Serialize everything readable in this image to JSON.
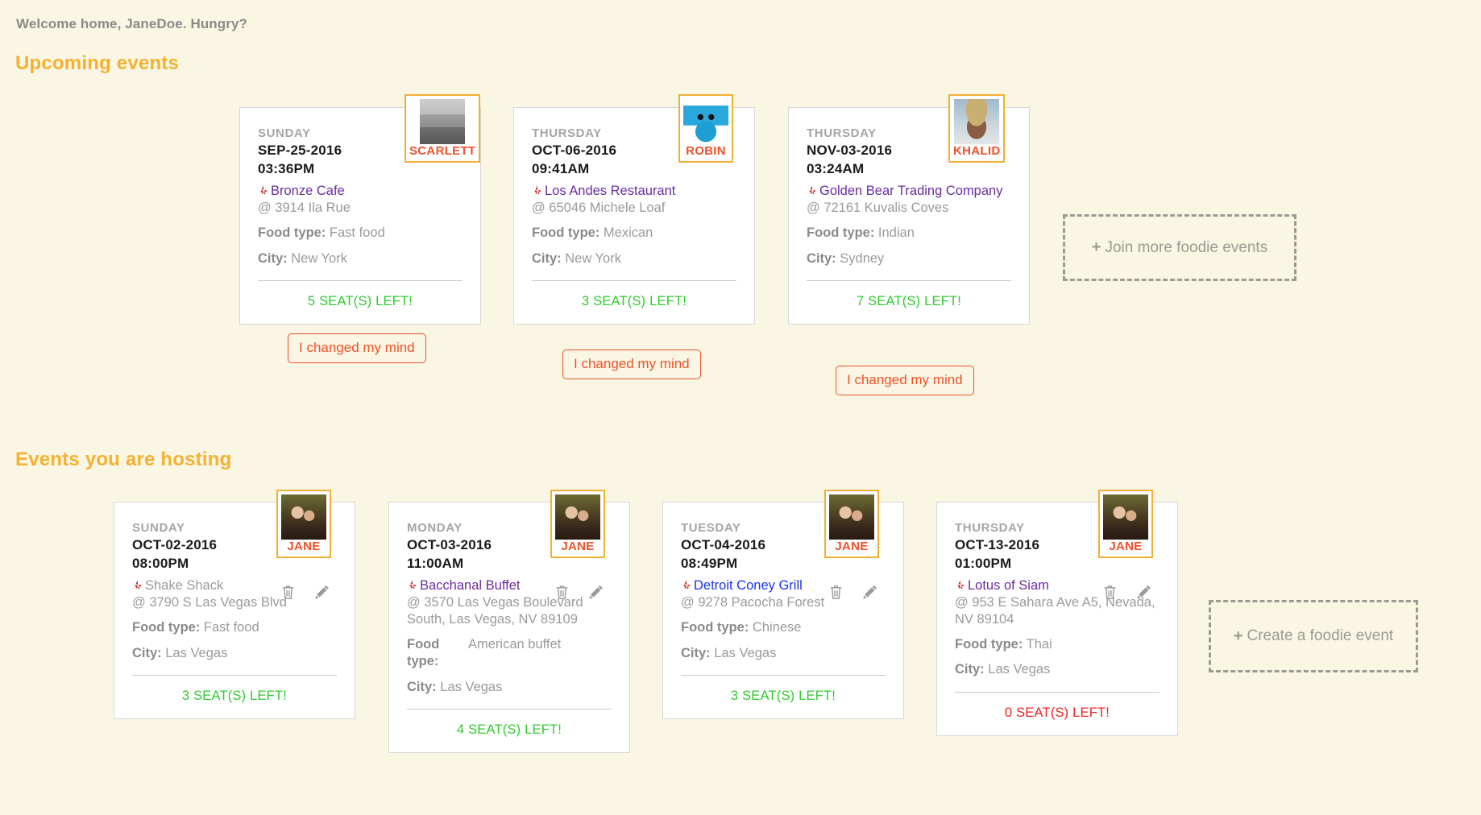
{
  "header": {
    "welcome": "Welcome home, JaneDoe. Hungry?",
    "upcoming_title": "Upcoming events",
    "hosting_title": "Events you are hosting"
  },
  "labels": {
    "food_type": "Food type:",
    "city": "City:",
    "changed_mind": "I changed my mind",
    "join_more": "Join more foodie events",
    "create_event": "Create a foodie event",
    "plus": "+"
  },
  "colors": {
    "background": "#faf6e4",
    "section_title": "#f5b130",
    "badge_border": "#f2b033",
    "badge_name": "#f0512a",
    "seats_ok": "#2ecc2e",
    "seats_none": "#ee2222",
    "link_visited": "#6b2ba0",
    "link_fresh": "#1a32f0",
    "muted": "#9a9a9a",
    "yelp_red": "#d32323"
  },
  "upcoming": [
    {
      "day": "SUNDAY",
      "date": "SEP-25-2016",
      "time": "03:36PM",
      "restaurant": "Bronze Cafe",
      "restaurant_style": "visited",
      "address": "@ 3914 Ila Rue",
      "food_type": "Fast food",
      "city": "New York",
      "seats": "5 SEAT(S) LEFT!",
      "seats_state": "ok",
      "host_name": "SCARLETT",
      "host_avatar": "photo-woman-bw",
      "action": "I changed my mind"
    },
    {
      "day": "THURSDAY",
      "date": "OCT-06-2016",
      "time": "09:41AM",
      "restaurant": "Los Andes Restaurant",
      "restaurant_style": "visited",
      "address": "@ 65046 Michele Loaf",
      "food_type": "Mexican",
      "city": "New York",
      "seats": "3 SEAT(S) LEFT!",
      "seats_state": "ok",
      "host_name": "ROBIN",
      "host_avatar": "robot-blue",
      "action": "I changed my mind"
    },
    {
      "day": "THURSDAY",
      "date": "NOV-03-2016",
      "time": "03:24AM",
      "restaurant": "Golden Bear Trading Company",
      "restaurant_style": "visited",
      "address": "@ 72161 Kuvalis Coves",
      "food_type": "Indian",
      "city": "Sydney",
      "seats": "7 SEAT(S) LEFT!",
      "seats_state": "ok",
      "host_name": "KHALID",
      "host_avatar": "photo-woman-hat",
      "action": "I changed my mind"
    }
  ],
  "hosting": [
    {
      "day": "SUNDAY",
      "date": "OCT-02-2016",
      "time": "08:00PM",
      "restaurant": "Shake Shack",
      "restaurant_style": "plain",
      "address": "@ 3790 S Las Vegas Blvd",
      "food_type": "Fast food",
      "city": "Las Vegas",
      "seats": "3 SEAT(S) LEFT!",
      "seats_state": "ok",
      "host_name": "JANE",
      "host_avatar": "photo-two-women"
    },
    {
      "day": "MONDAY",
      "date": "OCT-03-2016",
      "time": "11:00AM",
      "restaurant": "Bacchanal Buffet",
      "restaurant_style": "visited",
      "address": "@ 3570 Las Vegas Boulevard South, Las Vegas, NV 89109",
      "food_type": "American buffet",
      "food_type_wrap": true,
      "city": "Las Vegas",
      "seats": "4 SEAT(S) LEFT!",
      "seats_state": "ok",
      "host_name": "JANE",
      "host_avatar": "photo-two-women"
    },
    {
      "day": "TUESDAY",
      "date": "OCT-04-2016",
      "time": "08:49PM",
      "restaurant": "Detroit Coney Grill",
      "restaurant_style": "fresh",
      "address": "@ 9278 Pacocha Forest",
      "food_type": "Chinese",
      "city": "Las Vegas",
      "seats": "3 SEAT(S) LEFT!",
      "seats_state": "ok",
      "host_name": "JANE",
      "host_avatar": "photo-two-women"
    },
    {
      "day": "THURSDAY",
      "date": "OCT-13-2016",
      "time": "01:00PM",
      "restaurant": "Lotus of Siam",
      "restaurant_style": "visited",
      "address": "@ 953 E Sahara Ave A5, Nevada, NV 89104",
      "food_type": "Thai",
      "city": "Las Vegas",
      "seats": "0 SEAT(S) LEFT!",
      "seats_state": "none",
      "host_name": "JANE",
      "host_avatar": "photo-two-women"
    }
  ]
}
